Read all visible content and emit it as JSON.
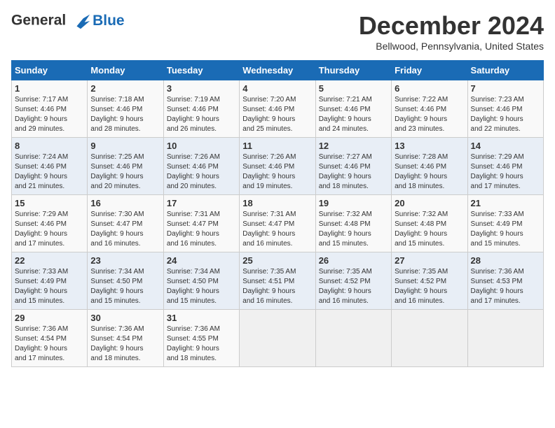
{
  "header": {
    "logo_line1": "General",
    "logo_line2": "Blue",
    "month_title": "December 2024",
    "location": "Bellwood, Pennsylvania, United States"
  },
  "weekdays": [
    "Sunday",
    "Monday",
    "Tuesday",
    "Wednesday",
    "Thursday",
    "Friday",
    "Saturday"
  ],
  "weeks": [
    [
      {
        "day": "1",
        "sunrise": "7:17 AM",
        "sunset": "4:46 PM",
        "daylight": "9 hours and 29 minutes."
      },
      {
        "day": "2",
        "sunrise": "7:18 AM",
        "sunset": "4:46 PM",
        "daylight": "9 hours and 28 minutes."
      },
      {
        "day": "3",
        "sunrise": "7:19 AM",
        "sunset": "4:46 PM",
        "daylight": "9 hours and 26 minutes."
      },
      {
        "day": "4",
        "sunrise": "7:20 AM",
        "sunset": "4:46 PM",
        "daylight": "9 hours and 25 minutes."
      },
      {
        "day": "5",
        "sunrise": "7:21 AM",
        "sunset": "4:46 PM",
        "daylight": "9 hours and 24 minutes."
      },
      {
        "day": "6",
        "sunrise": "7:22 AM",
        "sunset": "4:46 PM",
        "daylight": "9 hours and 23 minutes."
      },
      {
        "day": "7",
        "sunrise": "7:23 AM",
        "sunset": "4:46 PM",
        "daylight": "9 hours and 22 minutes."
      }
    ],
    [
      {
        "day": "8",
        "sunrise": "7:24 AM",
        "sunset": "4:46 PM",
        "daylight": "9 hours and 21 minutes."
      },
      {
        "day": "9",
        "sunrise": "7:25 AM",
        "sunset": "4:46 PM",
        "daylight": "9 hours and 20 minutes."
      },
      {
        "day": "10",
        "sunrise": "7:26 AM",
        "sunset": "4:46 PM",
        "daylight": "9 hours and 20 minutes."
      },
      {
        "day": "11",
        "sunrise": "7:26 AM",
        "sunset": "4:46 PM",
        "daylight": "9 hours and 19 minutes."
      },
      {
        "day": "12",
        "sunrise": "7:27 AM",
        "sunset": "4:46 PM",
        "daylight": "9 hours and 18 minutes."
      },
      {
        "day": "13",
        "sunrise": "7:28 AM",
        "sunset": "4:46 PM",
        "daylight": "9 hours and 18 minutes."
      },
      {
        "day": "14",
        "sunrise": "7:29 AM",
        "sunset": "4:46 PM",
        "daylight": "9 hours and 17 minutes."
      }
    ],
    [
      {
        "day": "15",
        "sunrise": "7:29 AM",
        "sunset": "4:46 PM",
        "daylight": "9 hours and 17 minutes."
      },
      {
        "day": "16",
        "sunrise": "7:30 AM",
        "sunset": "4:47 PM",
        "daylight": "9 hours and 16 minutes."
      },
      {
        "day": "17",
        "sunrise": "7:31 AM",
        "sunset": "4:47 PM",
        "daylight": "9 hours and 16 minutes."
      },
      {
        "day": "18",
        "sunrise": "7:31 AM",
        "sunset": "4:47 PM",
        "daylight": "9 hours and 16 minutes."
      },
      {
        "day": "19",
        "sunrise": "7:32 AM",
        "sunset": "4:48 PM",
        "daylight": "9 hours and 15 minutes."
      },
      {
        "day": "20",
        "sunrise": "7:32 AM",
        "sunset": "4:48 PM",
        "daylight": "9 hours and 15 minutes."
      },
      {
        "day": "21",
        "sunrise": "7:33 AM",
        "sunset": "4:49 PM",
        "daylight": "9 hours and 15 minutes."
      }
    ],
    [
      {
        "day": "22",
        "sunrise": "7:33 AM",
        "sunset": "4:49 PM",
        "daylight": "9 hours and 15 minutes."
      },
      {
        "day": "23",
        "sunrise": "7:34 AM",
        "sunset": "4:50 PM",
        "daylight": "9 hours and 15 minutes."
      },
      {
        "day": "24",
        "sunrise": "7:34 AM",
        "sunset": "4:50 PM",
        "daylight": "9 hours and 15 minutes."
      },
      {
        "day": "25",
        "sunrise": "7:35 AM",
        "sunset": "4:51 PM",
        "daylight": "9 hours and 16 minutes."
      },
      {
        "day": "26",
        "sunrise": "7:35 AM",
        "sunset": "4:52 PM",
        "daylight": "9 hours and 16 minutes."
      },
      {
        "day": "27",
        "sunrise": "7:35 AM",
        "sunset": "4:52 PM",
        "daylight": "9 hours and 16 minutes."
      },
      {
        "day": "28",
        "sunrise": "7:36 AM",
        "sunset": "4:53 PM",
        "daylight": "9 hours and 17 minutes."
      }
    ],
    [
      {
        "day": "29",
        "sunrise": "7:36 AM",
        "sunset": "4:54 PM",
        "daylight": "9 hours and 17 minutes."
      },
      {
        "day": "30",
        "sunrise": "7:36 AM",
        "sunset": "4:54 PM",
        "daylight": "9 hours and 18 minutes."
      },
      {
        "day": "31",
        "sunrise": "7:36 AM",
        "sunset": "4:55 PM",
        "daylight": "9 hours and 18 minutes."
      },
      null,
      null,
      null,
      null
    ]
  ],
  "labels": {
    "sunrise": "Sunrise:",
    "sunset": "Sunset:",
    "daylight": "Daylight:"
  }
}
